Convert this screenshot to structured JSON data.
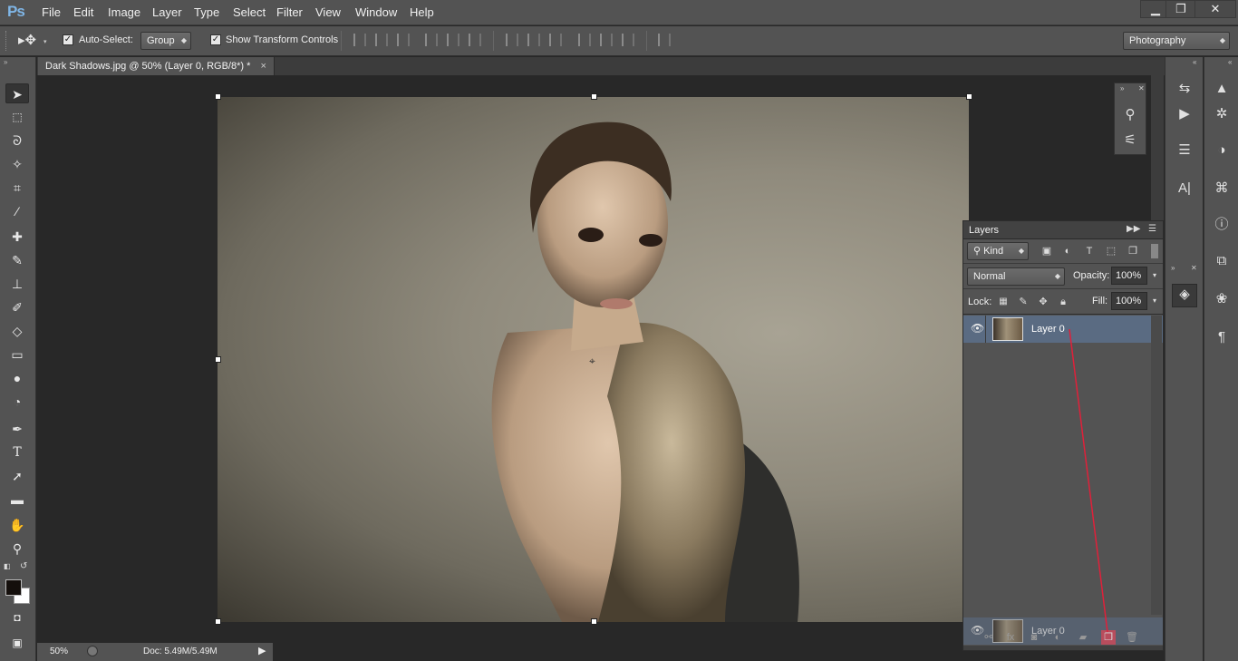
{
  "app": {
    "logo": "Ps"
  },
  "menu": [
    "File",
    "Edit",
    "Image",
    "Layer",
    "Type",
    "Select",
    "Filter",
    "View",
    "Window",
    "Help"
  ],
  "window_controls": {
    "minimize": "▁",
    "restore": "❐",
    "close": "✕"
  },
  "options": {
    "auto_select_label": "Auto-Select:",
    "auto_select_checked": true,
    "auto_select_target": "Group",
    "show_transform_label": "Show Transform Controls",
    "show_transform_checked": true,
    "workspace": "Photography"
  },
  "document": {
    "tab_title": "Dark Shadows.jpg @ 50% (Layer 0, RGB/8*) *",
    "tab_close": "×"
  },
  "status": {
    "zoom": "50%",
    "doc_info": "Doc: 5.49M/5.49M"
  },
  "layers_panel": {
    "title": "Layers",
    "filter_kind": "Kind",
    "blend_mode": "Normal",
    "opacity_label": "Opacity:",
    "opacity_value": "100%",
    "lock_label": "Lock:",
    "fill_label": "Fill:",
    "fill_value": "100%",
    "layer_name": "Layer 0",
    "dragged_layer_name": "Layer 0"
  },
  "colors": {
    "accent": "#5a6b82",
    "fg_swatch": "#000000",
    "bg_swatch": "#ffffff",
    "drag_line": "#e0203a"
  },
  "icons": [
    "move-icon",
    "marquee-icon",
    "lasso-icon",
    "magic-wand-icon",
    "crop-icon",
    "eyedropper-icon",
    "healing-icon",
    "brush-icon",
    "stamp-icon",
    "history-brush-icon",
    "eraser-icon",
    "gradient-icon",
    "blur-icon",
    "dodge-icon",
    "pen-icon",
    "type-icon",
    "path-select-icon",
    "rectangle-icon",
    "hand-icon",
    "zoom-icon"
  ]
}
